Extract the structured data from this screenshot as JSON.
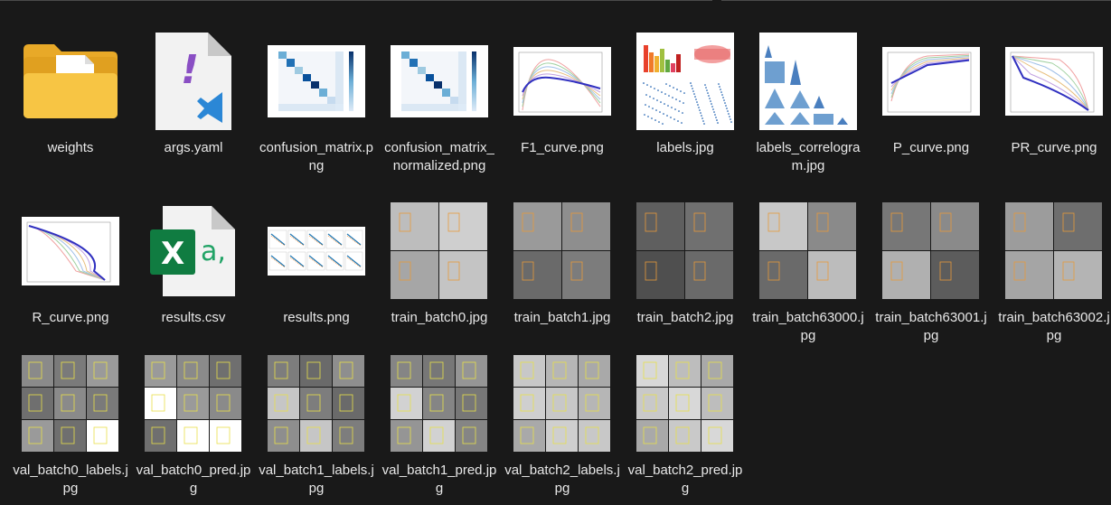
{
  "files": [
    {
      "name": "weights",
      "kind": "folder"
    },
    {
      "name": "args.yaml",
      "kind": "yaml"
    },
    {
      "name": "confusion_matrix.png",
      "kind": "confusion"
    },
    {
      "name": "confusion_matrix_normalized.png",
      "kind": "confusion"
    },
    {
      "name": "F1_curve.png",
      "kind": "curve"
    },
    {
      "name": "labels.jpg",
      "kind": "labels"
    },
    {
      "name": "labels_correlogram.jpg",
      "kind": "correlogram"
    },
    {
      "name": "P_curve.png",
      "kind": "curve"
    },
    {
      "name": "PR_curve.png",
      "kind": "curve"
    },
    {
      "name": "R_curve.png",
      "kind": "curve"
    },
    {
      "name": "results.csv",
      "kind": "csv"
    },
    {
      "name": "results.png",
      "kind": "results"
    },
    {
      "name": "train_batch0.jpg",
      "kind": "photo"
    },
    {
      "name": "train_batch1.jpg",
      "kind": "photo"
    },
    {
      "name": "train_batch2.jpg",
      "kind": "photo"
    },
    {
      "name": "train_batch63000.jpg",
      "kind": "photo"
    },
    {
      "name": "train_batch63001.jpg",
      "kind": "photo"
    },
    {
      "name": "train_batch63002.jpg",
      "kind": "photo"
    },
    {
      "name": "val_batch0_labels.jpg",
      "kind": "photo"
    },
    {
      "name": "val_batch0_pred.jpg",
      "kind": "photo"
    },
    {
      "name": "val_batch1_labels.jpg",
      "kind": "photo"
    },
    {
      "name": "val_batch1_pred.jpg",
      "kind": "photo"
    },
    {
      "name": "val_batch2_labels.jpg",
      "kind": "photo"
    },
    {
      "name": "val_batch2_pred.jpg",
      "kind": "photo"
    }
  ],
  "colors": {
    "background": "#191919",
    "text": "#e8e8e8",
    "folder": "#f7c544",
    "excel": "#107c41",
    "vscode": "#2b87d6",
    "yaml_mark": "#8a4fc4"
  }
}
